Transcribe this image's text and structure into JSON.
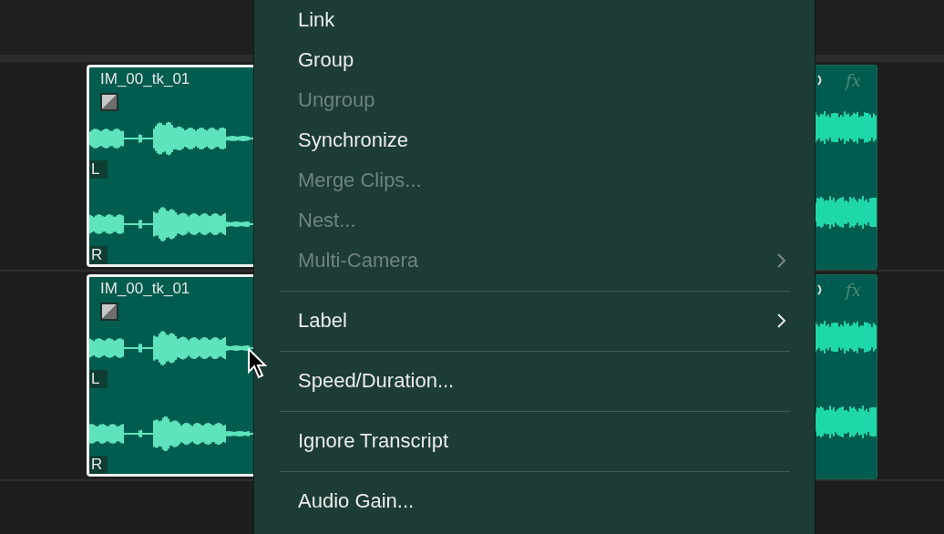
{
  "tracks": [
    {
      "clip": {
        "name": "IM_00_tk_01",
        "selected": true,
        "channels": [
          "L",
          "R"
        ]
      },
      "next_clip": {
        "effects": "fx"
      }
    },
    {
      "clip": {
        "name": "IM_00_tk_01",
        "selected": true,
        "channels": [
          "L",
          "R"
        ]
      },
      "next_clip": {
        "effects": "fx"
      }
    }
  ],
  "context_menu": {
    "items": [
      {
        "kind": "item",
        "label": "Link",
        "disabled": false,
        "submenu": false
      },
      {
        "kind": "item",
        "label": "Group",
        "disabled": false,
        "submenu": false
      },
      {
        "kind": "item",
        "label": "Ungroup",
        "disabled": true,
        "submenu": false
      },
      {
        "kind": "item",
        "label": "Synchronize",
        "disabled": false,
        "submenu": false
      },
      {
        "kind": "item",
        "label": "Merge Clips...",
        "disabled": true,
        "submenu": false
      },
      {
        "kind": "item",
        "label": "Nest...",
        "disabled": true,
        "submenu": false
      },
      {
        "kind": "item",
        "label": "Multi-Camera",
        "disabled": true,
        "submenu": true
      },
      {
        "kind": "separator"
      },
      {
        "kind": "item",
        "label": "Label",
        "disabled": false,
        "submenu": true
      },
      {
        "kind": "separator"
      },
      {
        "kind": "item",
        "label": "Speed/Duration...",
        "disabled": false,
        "submenu": false
      },
      {
        "kind": "separator"
      },
      {
        "kind": "item",
        "label": "Ignore Transcript",
        "disabled": false,
        "submenu": false
      },
      {
        "kind": "separator"
      },
      {
        "kind": "item",
        "label": "Audio Gain...",
        "disabled": false,
        "submenu": false
      }
    ]
  }
}
